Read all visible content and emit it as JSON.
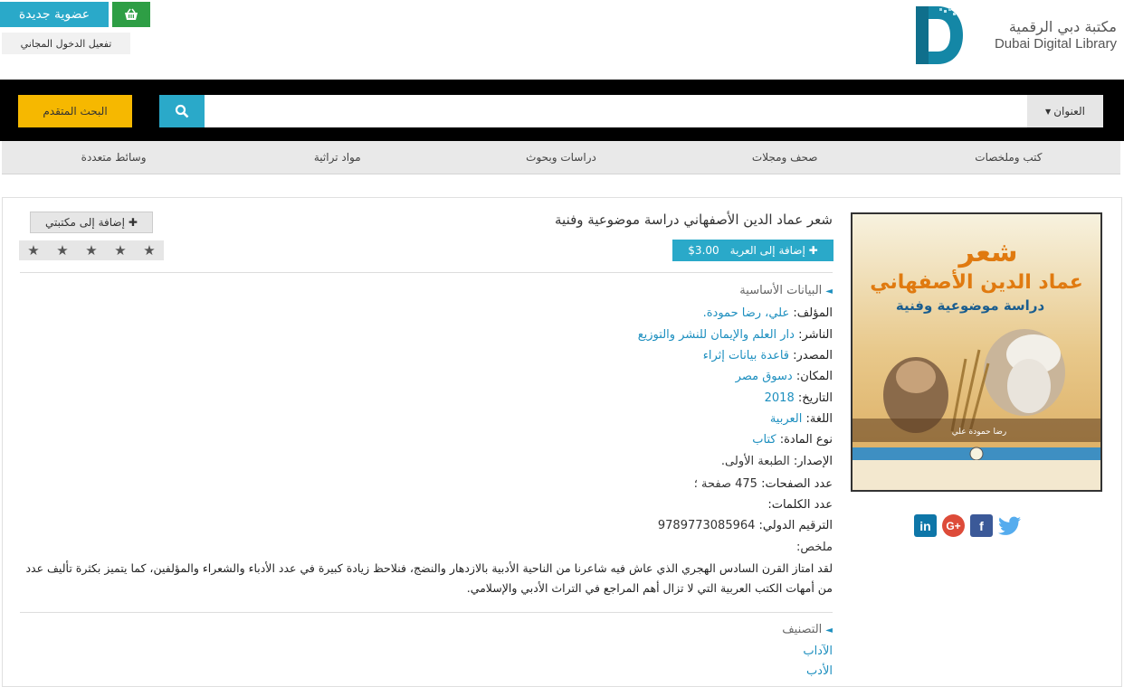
{
  "header": {
    "join_label": "عضوية جديدة",
    "free_access_label": "تفعيل الدخول المجاني",
    "logo_ar": "مكتبة دبي الرقمية",
    "logo_en": "Dubai Digital Library"
  },
  "search": {
    "advanced_label": "البحث المتقدم",
    "query": "",
    "field_selected": "العنوان"
  },
  "categories": [
    "كتب وملخصات",
    "صحف ومجلات",
    "دراسات وبحوث",
    "مواد تراثية",
    "وسائط متعددة"
  ],
  "book": {
    "title": "شعر عماد الدين الأصفهاني دراسة موضوعية وفنية",
    "add_to_cart_label": "إضافة إلى العربة",
    "price": "$3.00",
    "add_to_library_label": "إضافة إلى مكتبتي",
    "rating_stars": 5,
    "rating_value": 0,
    "cover": {
      "title_line1": "شعر",
      "title_line2": "عماد الدين الأصفهاني",
      "title_line3": "دراسة موضوعية وفنية",
      "author_band": "رضا حمودة علي"
    }
  },
  "basic_data": {
    "heading": "البيانات الأساسية",
    "author_label": "المؤلف:",
    "author": "علي، رضا حمودة.",
    "publisher_label": "الناشر:",
    "publisher": "دار العلم والإيمان للنشر والتوزيع",
    "source_label": "المصدر:",
    "source": "قاعدة بيانات إثراء",
    "place_label": "المكان:",
    "place": "دسوق مصر",
    "date_label": "التاريخ:",
    "date": "2018",
    "language_label": "اللغة:",
    "language": "العربية",
    "type_label": "نوع المادة:",
    "type": "كتاب",
    "edition_label": "الإصدار:",
    "edition": "الطبعة الأولى.",
    "pages_label": "عدد الصفحات:",
    "pages": "475 صفحة ؛",
    "words_label": "عدد الكلمات:",
    "words": "",
    "isbn_label": "الترقيم الدولي:",
    "isbn": "9789773085964",
    "summary_label": "ملخص:",
    "summary": "لقد امتاز القرن السادس الهجري الذي عاش فيه شاعرنا من الناحية الأدبية بالازدهار والنضج، فنلاحظ زيادة كبيرة في عدد الأدباء والشعراء والمؤلفين، كما يتميز بكثرة تأليف عدد من أمهات الكتب العربية التي لا تزال أهم المراجع في التراث الأدبي والإسلامي."
  },
  "classification": {
    "heading": "التصنيف",
    "items": [
      "الآداب",
      "الأدب"
    ]
  },
  "social": {
    "icons": [
      "linkedin-icon",
      "google-plus-icon",
      "facebook-icon",
      "twitter-icon"
    ]
  },
  "colors": {
    "accent": "#2aa9c9",
    "advanced_search": "#f6b800",
    "basket": "#2e9e45",
    "link": "#1d8fbf"
  }
}
